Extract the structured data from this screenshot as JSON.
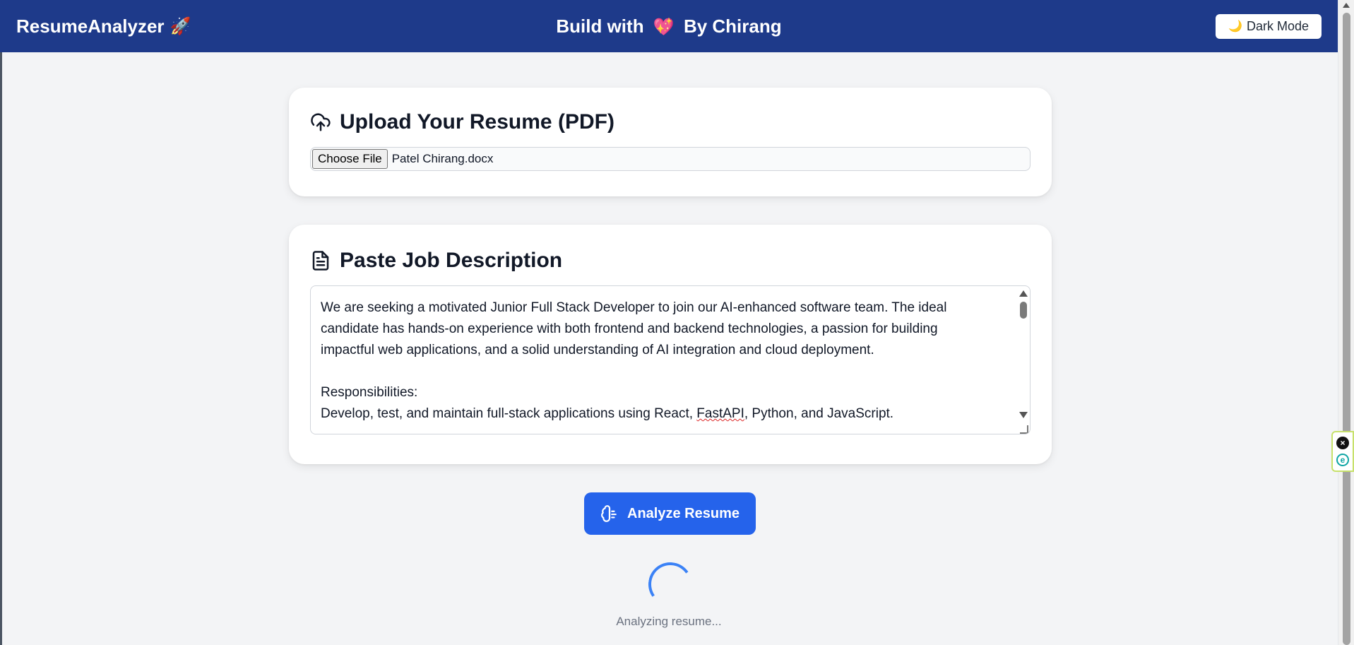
{
  "navbar": {
    "brand": "ResumeAnalyzer",
    "brand_icon": "🚀",
    "center_prefix": "Build with",
    "center_heart": "💖",
    "center_suffix": "By Chirang",
    "dark_mode_icon": "🌙",
    "dark_mode_label": "Dark Mode"
  },
  "upload": {
    "title": "Upload Your Resume (PDF)",
    "icon": "cloud-upload-icon",
    "choose_label": "Choose File",
    "file_name": "Patel Chirang.docx"
  },
  "job_description": {
    "title": "Paste Job Description",
    "icon": "document-icon",
    "lines": [
      "We are seeking a motivated Junior Full Stack Developer to join our AI-enhanced software team. The ideal",
      "candidate has hands-on experience with both frontend and backend technologies, a passion for building",
      "impactful web applications, and a solid understanding of AI integration and cloud deployment.",
      "",
      "Responsibilities:"
    ],
    "last_line_before": "Develop, test, and maintain full-stack applications using React, ",
    "last_line_flagged": "FastAPI",
    "last_line_after": ", Python, and JavaScript."
  },
  "analyze": {
    "label": "Analyze Resume",
    "icon": "brain-icon"
  },
  "status": {
    "text": "Analyzing resume..."
  },
  "colors": {
    "navbar": "#1e3a8a",
    "primary_button": "#2563eb",
    "spinner": "#3b82f6",
    "background": "#f3f4f6"
  }
}
